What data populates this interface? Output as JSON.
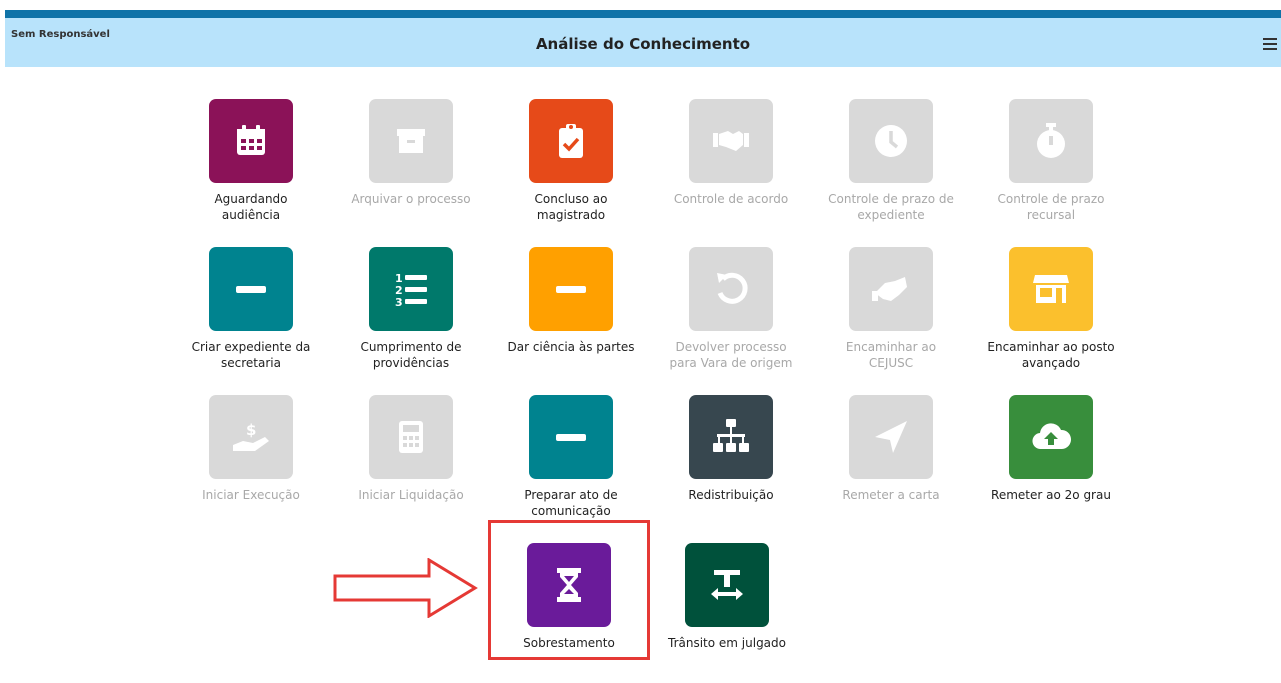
{
  "header": {
    "responsavel": "Sem Responsável",
    "title": "Análise do Conhecimento"
  },
  "colors": {
    "topbar": "#0f73a8",
    "header_bg": "#b8e3fb",
    "disabled_tile": "#d9d9d9",
    "highlight": "#e53935"
  },
  "tiles": [
    {
      "label": "Aguardando audiência",
      "icon": "calendar-icon",
      "color": "#8b1258",
      "enabled": true
    },
    {
      "label": "Arquivar o processo",
      "icon": "archive-icon",
      "color": "#d9d9d9",
      "enabled": false
    },
    {
      "label": "Concluso ao magistrado",
      "icon": "clipboard-check-icon",
      "color": "#e64a19",
      "enabled": true
    },
    {
      "label": "Controle de acordo",
      "icon": "handshake-icon",
      "color": "#d9d9d9",
      "enabled": false
    },
    {
      "label": "Controle de prazo de expediente",
      "icon": "clock-icon",
      "color": "#d9d9d9",
      "enabled": false
    },
    {
      "label": "Controle de prazo recursal",
      "icon": "stopwatch-icon",
      "color": "#d9d9d9",
      "enabled": false
    },
    {
      "label": "Criar expediente da secretaria",
      "icon": "minus-icon",
      "color": "#00838f",
      "enabled": true
    },
    {
      "label": "Cumprimento de providências",
      "icon": "numbered-list-icon",
      "color": "#00796b",
      "enabled": true
    },
    {
      "label": "Dar ciência às partes",
      "icon": "minus-icon",
      "color": "#ffa000",
      "enabled": true
    },
    {
      "label": "Devolver processo para Vara de origem",
      "icon": "undo-icon",
      "color": "#d9d9d9",
      "enabled": false
    },
    {
      "label": "Encaminhar ao CEJUSC",
      "icon": "handshake-icon",
      "color": "#d9d9d9",
      "enabled": false
    },
    {
      "label": "Encaminhar ao posto avançado",
      "icon": "store-icon",
      "color": "#fbc02d",
      "enabled": true
    },
    {
      "label": "Iniciar Execução",
      "icon": "hand-dollar-icon",
      "color": "#d9d9d9",
      "enabled": false
    },
    {
      "label": "Iniciar Liquidação",
      "icon": "calculator-icon",
      "color": "#d9d9d9",
      "enabled": false
    },
    {
      "label": "Preparar ato de comunicação",
      "icon": "minus-icon",
      "color": "#00838f",
      "enabled": true
    },
    {
      "label": "Redistribuição",
      "icon": "sitemap-icon",
      "color": "#37474f",
      "enabled": true
    },
    {
      "label": "Remeter a carta",
      "icon": "location-arrow-icon",
      "color": "#d9d9d9",
      "enabled": false
    },
    {
      "label": "Remeter ao 2o grau",
      "icon": "cloud-upload-icon",
      "color": "#388e3c",
      "enabled": true
    },
    {
      "label": "Sobrestamento",
      "icon": "hourglass-icon",
      "color": "#6a1b9a",
      "enabled": true
    },
    {
      "label": "Trânsito em julgado",
      "icon": "text-width-icon",
      "color": "#00513b",
      "enabled": true
    }
  ]
}
